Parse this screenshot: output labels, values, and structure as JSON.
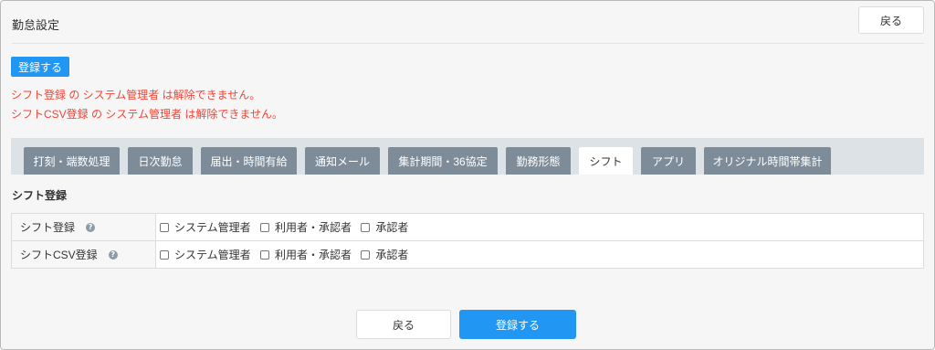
{
  "header": {
    "title": "勤怠設定",
    "back_label": "戻る"
  },
  "toolbar": {
    "register_label": "登録する"
  },
  "errors": [
    "シフト登録 の システム管理者 は解除できません。",
    "シフトCSV登録 の システム管理者 は解除できません。"
  ],
  "tabs": [
    {
      "label": "打刻・端数処理",
      "active": false
    },
    {
      "label": "日次勤怠",
      "active": false
    },
    {
      "label": "届出・時間有給",
      "active": false
    },
    {
      "label": "通知メール",
      "active": false
    },
    {
      "label": "集計期間・36協定",
      "active": false
    },
    {
      "label": "勤務形態",
      "active": false
    },
    {
      "label": "シフト",
      "active": true
    },
    {
      "label": "アプリ",
      "active": false
    },
    {
      "label": "オリジナル時間帯集計",
      "active": false
    }
  ],
  "section": {
    "title": "シフト登録"
  },
  "permissions": {
    "rows": [
      {
        "label": "シフト登録",
        "icon": "help-circle-icon",
        "options": [
          {
            "label": "システム管理者",
            "checked": false
          },
          {
            "label": "利用者・承認者",
            "checked": false
          },
          {
            "label": "承認者",
            "checked": false
          }
        ]
      },
      {
        "label": "シフトCSV登録",
        "icon": "help-circle-icon",
        "options": [
          {
            "label": "システム管理者",
            "checked": false
          },
          {
            "label": "利用者・承認者",
            "checked": false
          },
          {
            "label": "承認者",
            "checked": false
          }
        ]
      }
    ]
  },
  "footer": {
    "back_label": "戻る",
    "register_label": "登録する"
  },
  "colors": {
    "primary": "#2196f3",
    "error": "#f44336",
    "tab": "#7e8c9a",
    "tab_active": "#ffffff",
    "tab_bar": "#dde2e6",
    "help_icon": "#8d9ba8"
  }
}
